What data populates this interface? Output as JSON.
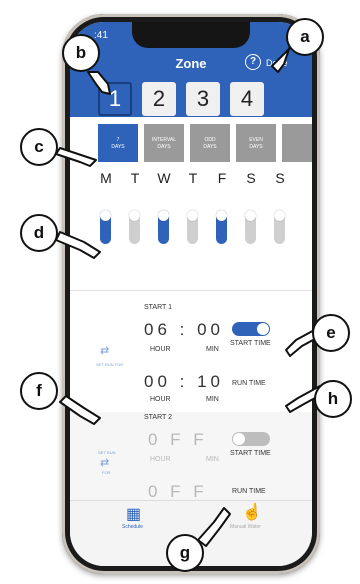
{
  "status_bar": {
    "time": ":41"
  },
  "header": {
    "title": "Zone",
    "help_glyph": "?",
    "done_label": "Done"
  },
  "zones": [
    "1",
    "2",
    "3",
    "4"
  ],
  "zone_selected": "1",
  "schedule_types": [
    {
      "line1": "7",
      "line2": "DAYS",
      "selected": true
    },
    {
      "line1": "INTERVAL",
      "line2": "DAYS",
      "selected": false
    },
    {
      "line1": "ODD",
      "line2": "DAYS",
      "selected": false
    },
    {
      "line1": "EVEN",
      "line2": "DAYS",
      "selected": false
    }
  ],
  "days": [
    "M",
    "T",
    "W",
    "T",
    "F",
    "S",
    "S"
  ],
  "day_toggles": [
    true,
    false,
    true,
    false,
    true,
    false,
    false
  ],
  "start1": {
    "title": "START 1",
    "start_time": "06 : 00",
    "hour_label": "HOUR",
    "min_label": "MIN",
    "start_toggle_label": "START TIME",
    "run_time": "00 : 10",
    "run_label": "RUN TIME",
    "link_caption": "SET RUN FOR"
  },
  "start2": {
    "title": "START 2",
    "start_time": "0   F F",
    "hour_label": "HOUR",
    "min_label": "MIN",
    "start_toggle_label": "START TIME",
    "run_time": "0   F F",
    "run_label": "RUN TIME",
    "link_caption_1": "SET RUN",
    "link_caption_2": "FOR"
  },
  "tabs": [
    {
      "label": "Schedule",
      "icon": "schedule-icon"
    },
    {
      "label": "Manual Water",
      "icon": "hand-icon"
    }
  ],
  "callouts": [
    "a",
    "b",
    "c",
    "d",
    "e",
    "f",
    "g",
    "h"
  ],
  "colors": {
    "accent": "#2e63b9",
    "inactive": "#9a9a9a"
  }
}
